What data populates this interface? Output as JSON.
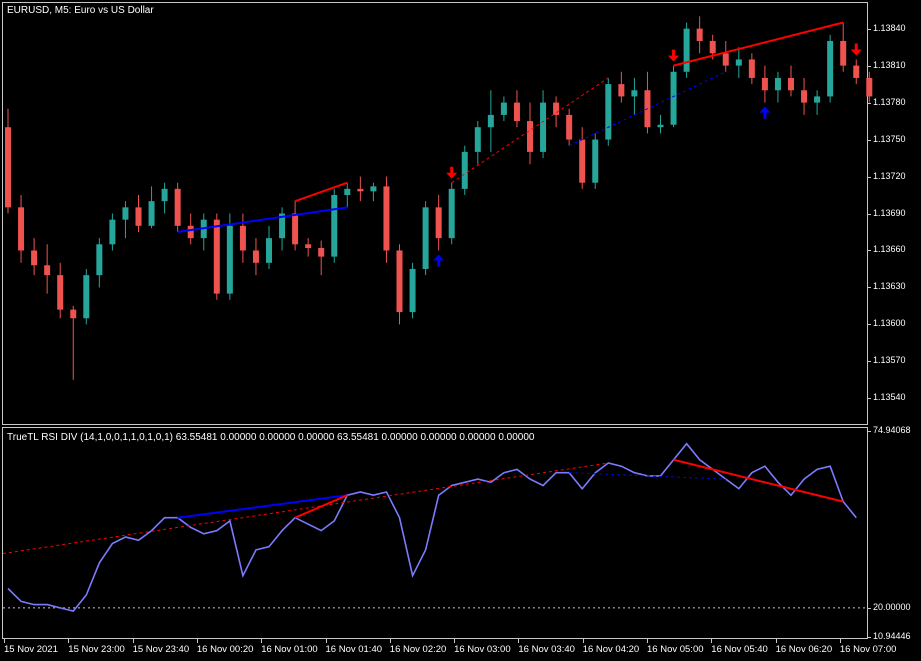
{
  "chart_title": "EURUSD, M5:  Euro vs US Dollar",
  "indicator_label": "TrueTL RSI DIV (14,1,0,0,1,1,0,1,0,1) 63.55481 0.00000 0.00000 0.00000 63.55481 0.00000 0.00000 0.00000 0.00000",
  "colors": {
    "background": "#000000",
    "bull_candle": "#26a69a",
    "bear_candle": "#ef5350",
    "rsi_line": "#7b7bff",
    "rsi_line_bright": "#1a1aff",
    "divergence_bear": "#ff0000",
    "divergence_bull": "#0000ff",
    "grid_border": "#c8c8c8"
  },
  "price_axis": [
    "1.13840",
    "1.13810",
    "1.13780",
    "1.13750",
    "1.13720",
    "1.13690",
    "1.13660",
    "1.13630",
    "1.13600",
    "1.13570",
    "1.13540"
  ],
  "indicator_axis": [
    "74.94068",
    "20.00000",
    "10.94446"
  ],
  "time_axis": [
    "15 Nov 2021",
    "15 Nov 23:00",
    "15 Nov 23:40",
    "16 Nov 00:20",
    "16 Nov 01:00",
    "16 Nov 01:40",
    "16 Nov 02:20",
    "16 Nov 03:00",
    "16 Nov 03:40",
    "16 Nov 04:20",
    "16 Nov 05:00",
    "16 Nov 05:40",
    "16 Nov 06:20",
    "16 Nov 07:00"
  ],
  "chart_data": [
    {
      "type": "candlestick",
      "title": "EURUSD, M5:  Euro vs US Dollar",
      "ylim": [
        1.1352,
        1.1386
      ],
      "candle_spacing_minutes": 5,
      "candles": [
        [
          1.1376,
          1.13775,
          1.1369,
          1.13695
        ],
        [
          1.13695,
          1.13705,
          1.1365,
          1.1366
        ],
        [
          1.1366,
          1.1367,
          1.1364,
          1.13648
        ],
        [
          1.13648,
          1.13665,
          1.13625,
          1.1364
        ],
        [
          1.1364,
          1.1365,
          1.13605,
          1.13612
        ],
        [
          1.13612,
          1.13615,
          1.13555,
          1.13605
        ],
        [
          1.13605,
          1.13645,
          1.136,
          1.1364
        ],
        [
          1.1364,
          1.1367,
          1.1363,
          1.13665
        ],
        [
          1.13665,
          1.1369,
          1.1366,
          1.13685
        ],
        [
          1.13685,
          1.137,
          1.1367,
          1.13695
        ],
        [
          1.13695,
          1.13705,
          1.13675,
          1.1368
        ],
        [
          1.1368,
          1.13712,
          1.13678,
          1.137
        ],
        [
          1.137,
          1.13715,
          1.1369,
          1.1371
        ],
        [
          1.1371,
          1.13715,
          1.13675,
          1.1368
        ],
        [
          1.1368,
          1.1369,
          1.13665,
          1.1367
        ],
        [
          1.1367,
          1.1369,
          1.1366,
          1.13685
        ],
        [
          1.13685,
          1.1369,
          1.1362,
          1.13625
        ],
        [
          1.13625,
          1.1369,
          1.1362,
          1.1368
        ],
        [
          1.1368,
          1.1369,
          1.1365,
          1.1366
        ],
        [
          1.1366,
          1.1367,
          1.1364,
          1.1365
        ],
        [
          1.1365,
          1.1368,
          1.13645,
          1.1367
        ],
        [
          1.1367,
          1.13695,
          1.1366,
          1.1369
        ],
        [
          1.1369,
          1.137,
          1.1366,
          1.13665
        ],
        [
          1.13665,
          1.1367,
          1.13655,
          1.13662
        ],
        [
          1.13662,
          1.13668,
          1.1364,
          1.13655
        ],
        [
          1.13655,
          1.1371,
          1.1365,
          1.13705
        ],
        [
          1.13705,
          1.13715,
          1.13695,
          1.1371
        ],
        [
          1.1371,
          1.1372,
          1.137,
          1.13708
        ],
        [
          1.13708,
          1.13715,
          1.137,
          1.13712
        ],
        [
          1.13712,
          1.1372,
          1.1365,
          1.1366
        ],
        [
          1.1366,
          1.13665,
          1.136,
          1.1361
        ],
        [
          1.1361,
          1.1365,
          1.13605,
          1.13645
        ],
        [
          1.13645,
          1.137,
          1.1364,
          1.13695
        ],
        [
          1.13695,
          1.13705,
          1.1366,
          1.1367
        ],
        [
          1.1367,
          1.13715,
          1.13665,
          1.1371
        ],
        [
          1.1371,
          1.13745,
          1.13705,
          1.1374
        ],
        [
          1.1374,
          1.13765,
          1.1373,
          1.1376
        ],
        [
          1.1376,
          1.1379,
          1.1374,
          1.1377
        ],
        [
          1.1377,
          1.13785,
          1.13765,
          1.1378
        ],
        [
          1.1378,
          1.1379,
          1.1376,
          1.13765
        ],
        [
          1.13765,
          1.1378,
          1.1373,
          1.1374
        ],
        [
          1.1374,
          1.1379,
          1.13735,
          1.1378
        ],
        [
          1.1378,
          1.13785,
          1.1376,
          1.1377
        ],
        [
          1.1377,
          1.13775,
          1.13745,
          1.1375
        ],
        [
          1.1375,
          1.1376,
          1.1371,
          1.13715
        ],
        [
          1.13715,
          1.13755,
          1.1371,
          1.1375
        ],
        [
          1.1375,
          1.138,
          1.13745,
          1.13795
        ],
        [
          1.13795,
          1.13805,
          1.1378,
          1.13785
        ],
        [
          1.13785,
          1.138,
          1.1377,
          1.1379
        ],
        [
          1.1379,
          1.13805,
          1.13755,
          1.1376
        ],
        [
          1.1376,
          1.1377,
          1.13755,
          1.13762
        ],
        [
          1.13762,
          1.1381,
          1.1376,
          1.13805
        ],
        [
          1.13805,
          1.13845,
          1.138,
          1.1384
        ],
        [
          1.1384,
          1.1385,
          1.1382,
          1.1383
        ],
        [
          1.1383,
          1.13835,
          1.13815,
          1.1382
        ],
        [
          1.1382,
          1.1383,
          1.13805,
          1.1381
        ],
        [
          1.1381,
          1.13825,
          1.138,
          1.13815
        ],
        [
          1.13815,
          1.1382,
          1.13795,
          1.138
        ],
        [
          1.138,
          1.1381,
          1.1378,
          1.1379
        ],
        [
          1.1379,
          1.13805,
          1.1378,
          1.138
        ],
        [
          1.138,
          1.1381,
          1.13785,
          1.1379
        ],
        [
          1.1379,
          1.138,
          1.1377,
          1.1378
        ],
        [
          1.1378,
          1.1379,
          1.1377,
          1.13785
        ],
        [
          1.13785,
          1.13835,
          1.1378,
          1.1383
        ],
        [
          1.1383,
          1.13845,
          1.13805,
          1.1381
        ],
        [
          1.1381,
          1.13815,
          1.13795,
          1.138
        ],
        [
          1.138,
          1.13805,
          1.1378,
          1.13785
        ]
      ],
      "annotations": [
        {
          "type": "bear_arrow",
          "candle": 34
        },
        {
          "type": "bull_arrow",
          "candle": 33
        },
        {
          "type": "bear_arrow",
          "candle": 51
        },
        {
          "type": "bull_arrow",
          "candle": 58
        },
        {
          "type": "bear_arrow",
          "candle": 65
        }
      ]
    },
    {
      "type": "line",
      "title": "TrueTL RSI DIV (14,1,0,0,1,1,0,1,0,1)",
      "ylim": [
        10.94446,
        74.94068
      ],
      "reference_line": 20.0,
      "values": [
        26,
        22,
        21,
        21,
        20,
        19,
        24,
        34,
        40,
        42,
        41,
        44,
        48,
        48,
        45,
        43,
        44,
        47,
        30,
        38,
        39,
        44,
        48,
        46,
        44,
        47,
        55,
        56,
        55,
        56,
        48,
        30,
        38,
        55,
        58,
        59,
        60,
        59,
        62,
        63,
        60,
        58,
        62,
        62,
        57,
        62,
        65,
        64,
        62,
        61,
        61,
        66,
        71,
        66,
        63,
        60,
        57,
        62,
        64,
        59,
        55,
        60,
        63,
        64,
        53,
        48
      ]
    }
  ]
}
